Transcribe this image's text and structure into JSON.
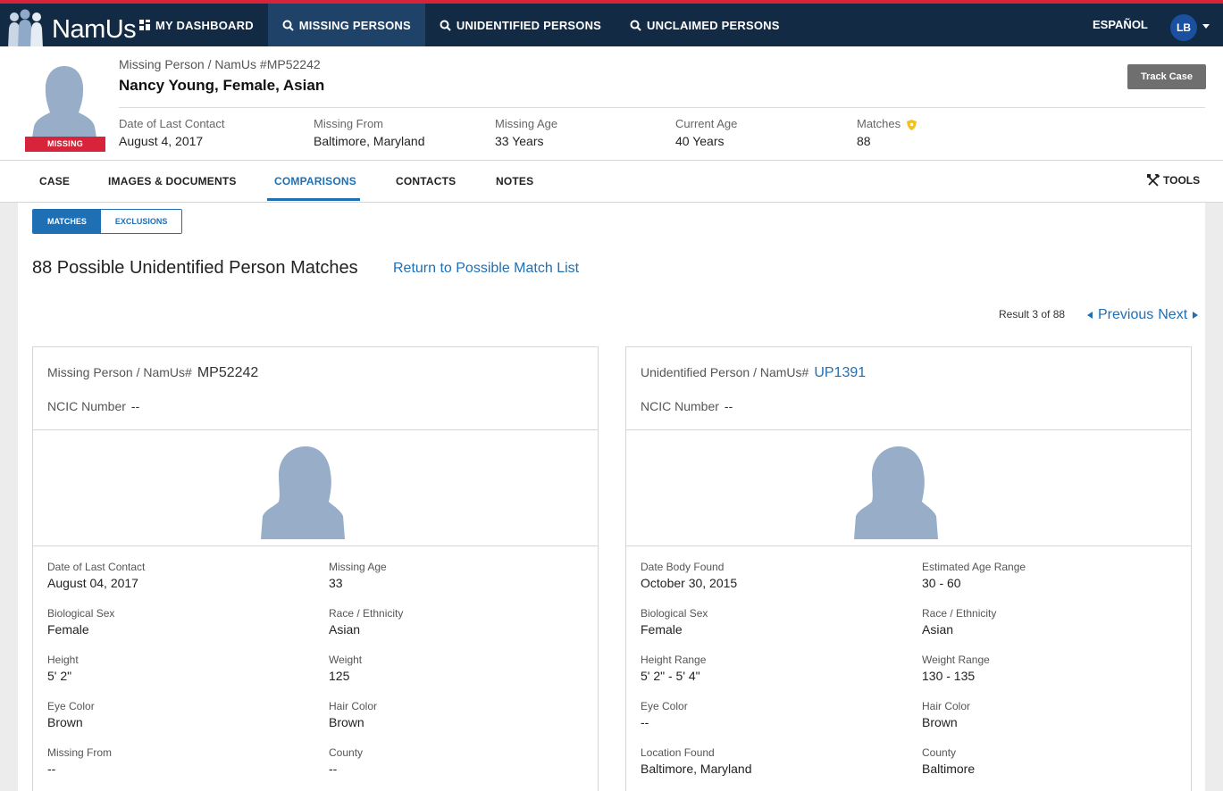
{
  "topnav": {
    "logo_text": "NamUs",
    "items": [
      {
        "label": "MY DASHBOARD",
        "icon": "dashboard-icon"
      },
      {
        "label": "MISSING PERSONS",
        "icon": "search-icon"
      },
      {
        "label": "UNIDENTIFIED PERSONS",
        "icon": "search-icon"
      },
      {
        "label": "UNCLAIMED PERSONS",
        "icon": "search-icon"
      }
    ],
    "language": "ESPAÑOL",
    "user_initials": "LB"
  },
  "case": {
    "subtitle": "Missing Person / NamUs #MP52242",
    "title": "Nancy Young, Female, Asian",
    "status_badge": "MISSING",
    "track_button": "Track Case",
    "stats": [
      {
        "label": "Date of Last Contact",
        "value": "August 4, 2017"
      },
      {
        "label": "Missing From",
        "value": "Baltimore, Maryland"
      },
      {
        "label": "Missing Age",
        "value": "33 Years"
      },
      {
        "label": "Current Age",
        "value": "40 Years"
      },
      {
        "label": "Matches",
        "value": "88"
      }
    ]
  },
  "tabs": {
    "items": [
      "CASE",
      "IMAGES & DOCUMENTS",
      "COMPARISONS",
      "CONTACTS",
      "NOTES"
    ],
    "active": "COMPARISONS",
    "tools": "TOOLS"
  },
  "comparisons": {
    "toggle_matches": "MATCHES",
    "toggle_exclusions": "EXCLUSIONS",
    "heading": "88 Possible Unidentified Person Matches",
    "return_link": "Return to Possible Match List",
    "result_count": "Result 3 of 88",
    "previous": "Previous",
    "next": "Next"
  },
  "left_card": {
    "id_label": "Missing Person / NamUs#",
    "id_value": "MP52242",
    "ncic_label": "NCIC Number",
    "ncic_value": "--",
    "fields": [
      {
        "label": "Date of Last Contact",
        "value": "August 04, 2017"
      },
      {
        "label": "Missing Age",
        "value": "33"
      },
      {
        "label": "Biological Sex",
        "value": "Female"
      },
      {
        "label": "Race / Ethnicity",
        "value": "Asian"
      },
      {
        "label": "Height",
        "value": "5' 2\""
      },
      {
        "label": "Weight",
        "value": "125"
      },
      {
        "label": "Eye Color",
        "value": "Brown"
      },
      {
        "label": "Hair Color",
        "value": "Brown"
      },
      {
        "label": "Missing From",
        "value": "--"
      },
      {
        "label": "County",
        "value": "--"
      }
    ]
  },
  "right_card": {
    "id_label": "Unidentified Person / NamUs#",
    "id_value": "UP1391",
    "ncic_label": "NCIC Number",
    "ncic_value": "--",
    "fields": [
      {
        "label": "Date Body Found",
        "value": "October 30, 2015"
      },
      {
        "label": "Estimated Age Range",
        "value": "30 - 60"
      },
      {
        "label": "Biological Sex",
        "value": "Female"
      },
      {
        "label": "Race / Ethnicity",
        "value": "Asian"
      },
      {
        "label": "Height Range",
        "value": "5' 2\" - 5' 4\""
      },
      {
        "label": "Weight Range",
        "value": "130 - 135"
      },
      {
        "label": "Eye Color",
        "value": "--"
      },
      {
        "label": "Hair Color",
        "value": "Brown"
      },
      {
        "label": "Location Found",
        "value": "Baltimore, Maryland"
      },
      {
        "label": "County",
        "value": "Baltimore"
      }
    ]
  },
  "colors": {
    "nav_bg": "#122a44",
    "nav_active": "#1f4268",
    "accent_red": "#d8243a",
    "link_blue": "#1f6fb5",
    "silhouette": "#97adc8"
  }
}
